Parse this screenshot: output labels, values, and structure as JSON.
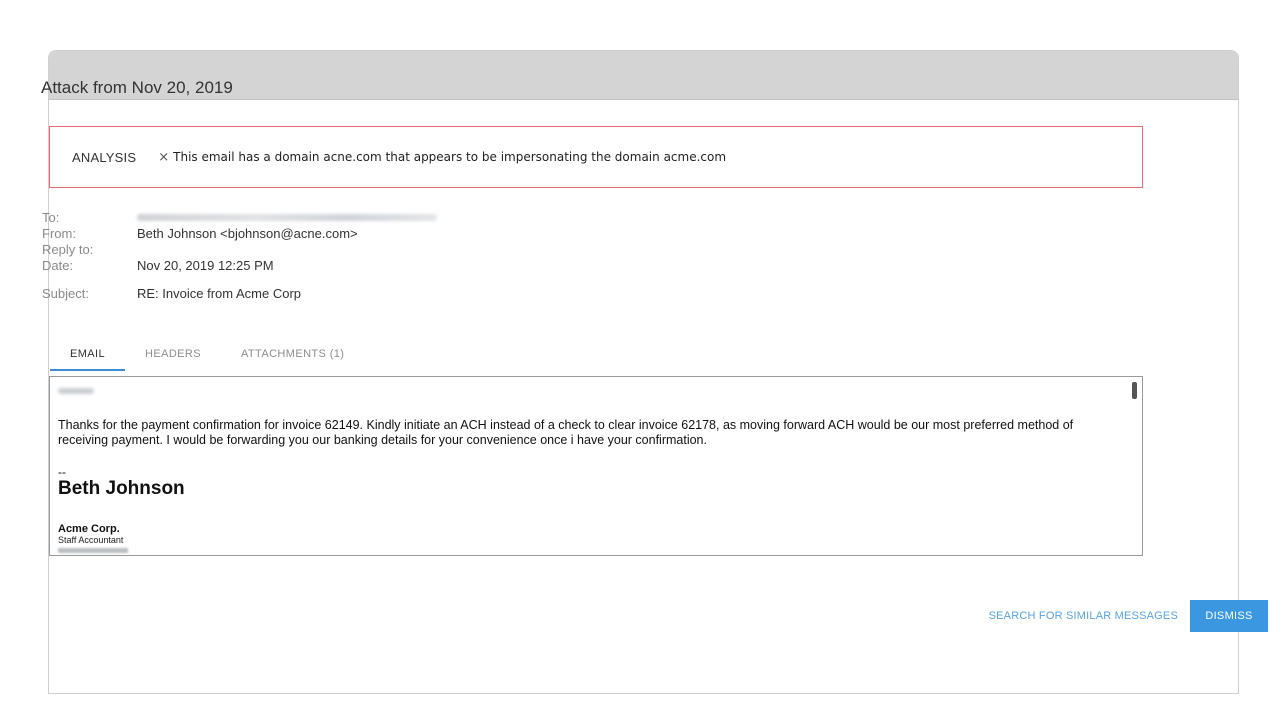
{
  "modal": {
    "title": "Attack from Nov 20, 2019"
  },
  "analysis": {
    "label": "ANALYSIS",
    "icon": "x-icon",
    "icon_glyph": "×",
    "message": "This email has a domain acne.com that appears to be impersonating the domain acme.com"
  },
  "meta": {
    "to_label": "To:",
    "from_label": "From:",
    "from_value": "Beth Johnson <bjohnson@acne.com>",
    "reply_to_label": "Reply to:",
    "date_label": "Date:",
    "date_value": "Nov 20, 2019 12:25 PM",
    "subject_label": "Subject:",
    "subject_value": "RE: Invoice from Acme Corp"
  },
  "tabs": [
    {
      "label": "EMAIL",
      "active": true
    },
    {
      "label": "HEADERS",
      "active": false
    },
    {
      "label": "ATTACHMENTS (1)",
      "active": false
    }
  ],
  "email": {
    "body": "Thanks for the payment confirmation for invoice 62149. Kindly initiate an ACH instead of a check to clear invoice 62178, as moving forward ACH would be our most preferred method of receiving payment. I would be forwarding you our banking details for your convenience once i have your confirmation.",
    "sig_dash": "--",
    "sig_name": "Beth Johnson",
    "sig_company": "Acme Corp.",
    "sig_title": "Staff Accountant"
  },
  "footer": {
    "search_label": "SEARCH FOR SIMILAR MESSAGES",
    "dismiss_label": "DISMISS"
  },
  "colors": {
    "accent": "#3a97e0",
    "alert_border": "#e36b72",
    "header_bg": "#d4d4d4"
  }
}
